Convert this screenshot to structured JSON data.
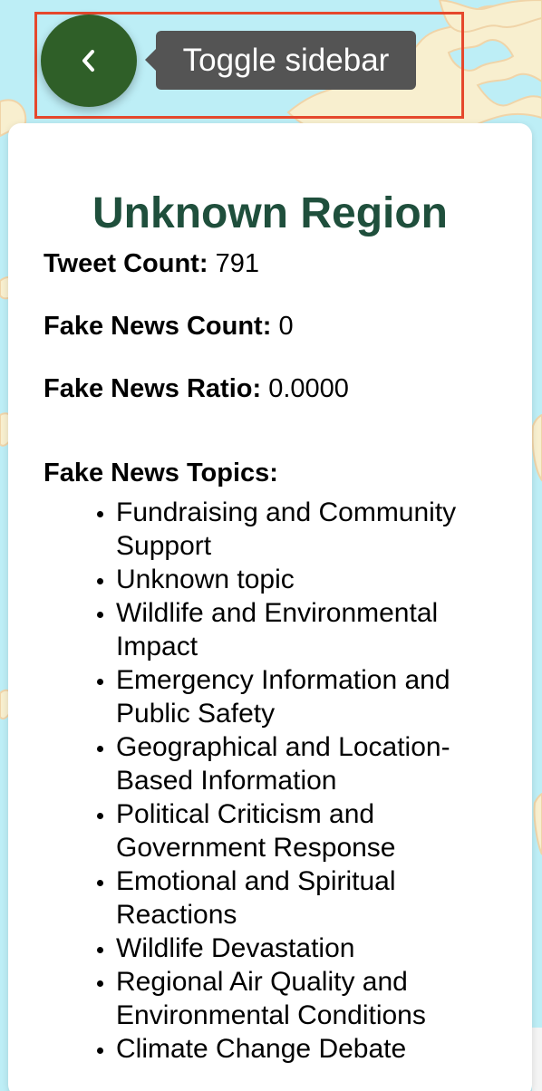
{
  "map": {
    "water_color": "#bdeef6",
    "land_color": "#f8efcf",
    "border_color": "#f0d4a8"
  },
  "toggle": {
    "icon": "chevron-left-icon",
    "button_color": "#2f5f28",
    "tooltip": "Toggle sidebar"
  },
  "highlight": {
    "color": "#e5482d"
  },
  "panel": {
    "title": "Unknown Region",
    "stats": {
      "tweet_count_label": "Tweet Count:",
      "tweet_count_value": "791",
      "fake_news_count_label": "Fake News Count:",
      "fake_news_count_value": "0",
      "fake_news_ratio_label": "Fake News Ratio:",
      "fake_news_ratio_value": "0.0000"
    },
    "topics_heading": "Fake News Topics:",
    "topics": [
      "Fundraising and Community Support",
      "Unknown topic",
      "Wildlife and Environmental Impact",
      "Emergency Information and Public Safety",
      "Geographical and Location-Based Information",
      "Political Criticism and Government Response",
      "Emotional and Spiritual Reactions",
      "Wildlife Devastation",
      "Regional Air Quality and Environmental Conditions",
      "Climate Change Debate"
    ]
  }
}
